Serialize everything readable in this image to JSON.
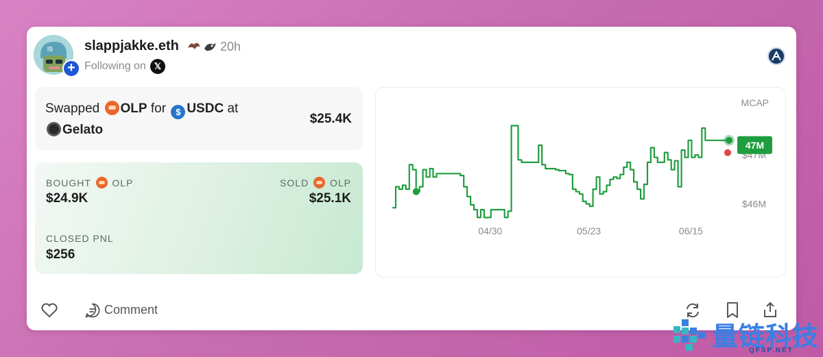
{
  "post": {
    "user_name": "slappjakke.eth",
    "time": "20h",
    "following_label": "Following on",
    "following_platform": "X"
  },
  "swap": {
    "verb": "Swapped",
    "from_token": "OLP",
    "connector_for": "for",
    "to_token": "USDC",
    "connector_at": "at",
    "venue": "Gelato",
    "amount": "$25.4K"
  },
  "trade": {
    "bought_label": "BOUGHT",
    "bought_token": "OLP",
    "bought_value": "$24.9K",
    "sold_label": "SOLD",
    "sold_token": "OLP",
    "sold_value": "$25.1K",
    "pnl_label": "CLOSED PNL",
    "pnl_value": "$256"
  },
  "actions": {
    "comment_label": "Comment"
  },
  "watermark": {
    "text": "量链科技",
    "sub": "QFSP.NET"
  },
  "colors": {
    "line": "#1f9d3f",
    "sell_marker": "#e04848",
    "badge": "#1f9d3f",
    "accent_blue": "#1f57d6"
  },
  "chart_data": {
    "type": "line",
    "title": "",
    "ylabel": "MCAP",
    "y_tick_labels": [
      "$47M",
      "$46M"
    ],
    "y_ticks": [
      47,
      46
    ],
    "x_tick_labels": [
      "04/30",
      "05/23",
      "06/15"
    ],
    "current_value_label": "47M",
    "ylim": [
      45.6,
      47.9
    ],
    "series": [
      {
        "values": [
          45.92,
          46.35,
          46.3,
          46.38,
          46.3,
          46.8,
          46.7,
          46.25,
          46.35,
          46.7,
          46.55,
          46.72,
          46.55,
          46.62,
          46.62,
          46.62,
          46.62,
          46.62,
          46.62,
          46.62,
          46.58,
          46.35,
          46.15,
          45.98,
          45.88,
          45.72,
          45.88,
          45.72,
          45.72,
          45.88,
          45.88,
          45.88,
          45.88,
          45.72,
          45.85,
          47.6,
          47.6,
          46.9,
          46.85,
          46.85,
          46.85,
          46.85,
          46.85,
          47.2,
          46.8,
          46.72,
          46.72,
          46.72,
          46.7,
          46.68,
          46.68,
          46.62,
          46.6,
          46.3,
          46.25,
          46.2,
          46.05,
          46.0,
          45.95,
          46.3,
          46.55,
          46.2,
          46.25,
          46.38,
          46.5,
          46.55,
          46.52,
          46.6,
          46.75,
          46.85,
          46.7,
          46.45,
          46.3,
          46.1,
          46.4,
          46.85,
          47.15,
          46.95,
          46.85,
          46.85,
          47.05,
          46.9,
          46.7,
          46.88,
          46.35,
          47.1,
          46.95,
          47.3,
          46.95,
          47.0,
          46.95,
          47.55,
          47.3,
          47.3,
          47.3,
          47.3,
          47.3,
          47.3,
          47.3,
          47.3
        ]
      }
    ],
    "buy_index": 7,
    "sell_index": 99
  }
}
